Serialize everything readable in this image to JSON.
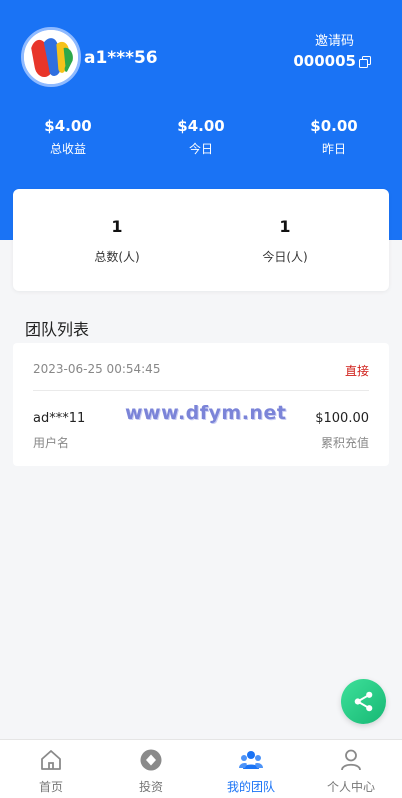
{
  "profile": {
    "username": "a1***56",
    "invite_label": "邀请码",
    "invite_code": "000005"
  },
  "earnings": [
    {
      "value": "$4.00",
      "label": "总收益"
    },
    {
      "value": "$4.00",
      "label": "今日"
    },
    {
      "value": "$0.00",
      "label": "昨日"
    }
  ],
  "team_counts": [
    {
      "value": "1",
      "label": "总数(人)"
    },
    {
      "value": "1",
      "label": "今日(人)"
    }
  ],
  "team_list": {
    "title": "团队列表",
    "items": [
      {
        "time": "2023-06-25 00:54:45",
        "type": "直接",
        "name": "ad***11",
        "name_label": "用户名",
        "amount": "$100.00",
        "amount_label": "累积充值"
      }
    ]
  },
  "watermark": "www.dfym.net",
  "tabs": [
    {
      "label": "首页",
      "icon": "home-icon"
    },
    {
      "label": "投资",
      "icon": "invest-icon"
    },
    {
      "label": "我的团队",
      "icon": "team-icon",
      "active": true
    },
    {
      "label": "个人中心",
      "icon": "person-icon"
    }
  ],
  "colors": {
    "primary": "#1a73f5",
    "type_label": "#d0201a",
    "share_button": "#22c47f"
  }
}
